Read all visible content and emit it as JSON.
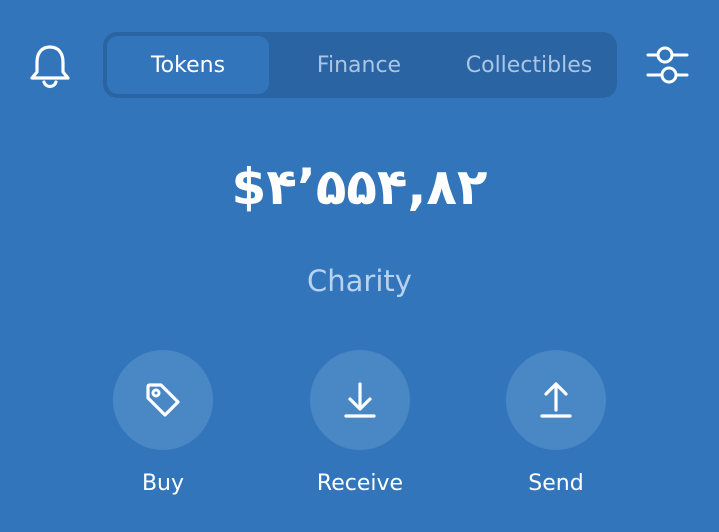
{
  "header": {
    "tabs": [
      {
        "label": "Tokens",
        "active": true
      },
      {
        "label": "Finance",
        "active": false
      },
      {
        "label": "Collectibles",
        "active": false
      }
    ],
    "left_icon": "bell-icon",
    "right_icon": "filter-sliders-icon"
  },
  "wallet": {
    "balance": "$۴’۵۵۴,۸۲",
    "name": "Charity"
  },
  "actions": [
    {
      "label": "Buy",
      "icon": "tag-icon"
    },
    {
      "label": "Receive",
      "icon": "download-arrow-icon"
    },
    {
      "label": "Send",
      "icon": "upload-arrow-icon"
    }
  ],
  "colors": {
    "background": "#3375bb",
    "segmented_bg": "#2b64a2",
    "action_circle": "#4a87c5",
    "muted_text": "#b9d2ee"
  }
}
